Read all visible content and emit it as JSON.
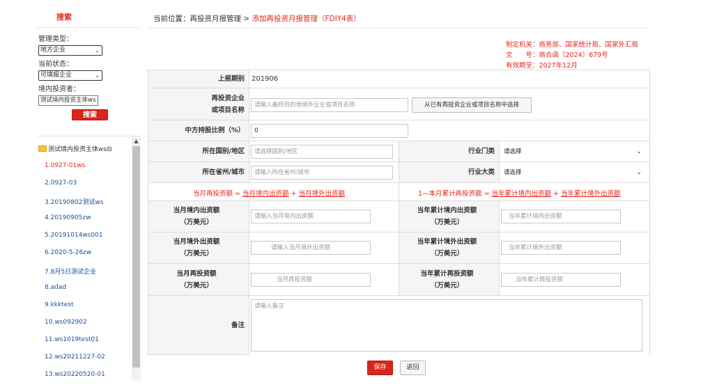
{
  "sidebar": {
    "header": "搜索",
    "type_label": "管理类型：",
    "type_value": "地方企业",
    "status_label": "当前状态：",
    "status_value": "可填报企业",
    "investor_label": "境内投资者：",
    "investor_value": "测试境内投资主体ws",
    "search_button": "搜索",
    "tree_root": "测试境内投资主体ws",
    "tree_toggle": "⊟",
    "items": [
      "1.0927-01ws",
      "2.0927-03",
      "3.20190802测试ws",
      "4.20190905zw",
      "5.20191014ws001",
      "6.2020-5-26zw",
      "7.8月5日测试企业",
      "8.adad",
      "9.kkktest",
      "10.ws092902",
      "11.ws1019test01",
      "12.ws20211227-02",
      "13.ws20220520-01"
    ]
  },
  "breadcrumb": {
    "prefix": "当前位置：再投资月报管理 > ",
    "current": "添加再投资月报管理（FDIY4表）"
  },
  "regulation": {
    "authority": "制定机关：商务部、国家统计局、国家外汇局",
    "doc_no": "文　　号：商合函〔2024〕679号",
    "valid": "有效期至：2027年12月"
  },
  "form": {
    "period_label": "上报期别",
    "period_value": "201906",
    "enterprise_label": "再投资企业\n或项目名称",
    "enterprise_placeholder": "请输入最终目的地境外企业或项目名称",
    "choose_button": "从已有再投资企业或项目名称中选择",
    "ratio_label": "中方持股比例（%）",
    "ratio_value": "0",
    "country_label": "所在国别/地区",
    "country_placeholder": "请选择国别/地区",
    "industry_cat_label": "行业门类",
    "industry_cat_value": "请选择",
    "province_label": "所在省州/城市",
    "province_placeholder": "请输入所在省州/城市",
    "industry_major_label": "行业大类",
    "industry_major_value": "请选择",
    "formula_month_pre": "当月再投资额 = ",
    "formula_month_a": "当月境内出资额",
    "formula_month_mid": " + ",
    "formula_month_b": "当月境外出资额",
    "formula_year_pre": "1—本月累计再投资额 = ",
    "formula_year_a": "当年累计境内出资额",
    "formula_year_mid": " + ",
    "formula_year_b": "当年累计境外出资额",
    "m_domestic_label": "当月境内出资额\n（万美元）",
    "m_domestic_placeholder": "请输入当月境内出资额",
    "y_domestic_label": "当年累计境内出资额\n（万美元）",
    "y_domestic_placeholder": "当年累计境内出资额",
    "m_foreign_label": "当月境外出资额\n（万美元）",
    "m_foreign_placeholder": "请输入当月境外出资额",
    "y_foreign_label": "当年累计境外出资额\n（万美元）",
    "y_foreign_placeholder": "当年累计境外出资额",
    "m_reinvest_label": "当月再投资额\n（万美元）",
    "m_reinvest_placeholder": "当月再投资额",
    "y_reinvest_label": "当年累计再投资额\n（万美元）",
    "y_reinvest_placeholder": "当年累计再投资额",
    "remark_label": "备注",
    "remark_placeholder": "请输入备注"
  },
  "footer": {
    "save": "保存",
    "back": "返回"
  },
  "colors": {
    "accent": "#e6261b",
    "link": "#1a4e9b"
  }
}
